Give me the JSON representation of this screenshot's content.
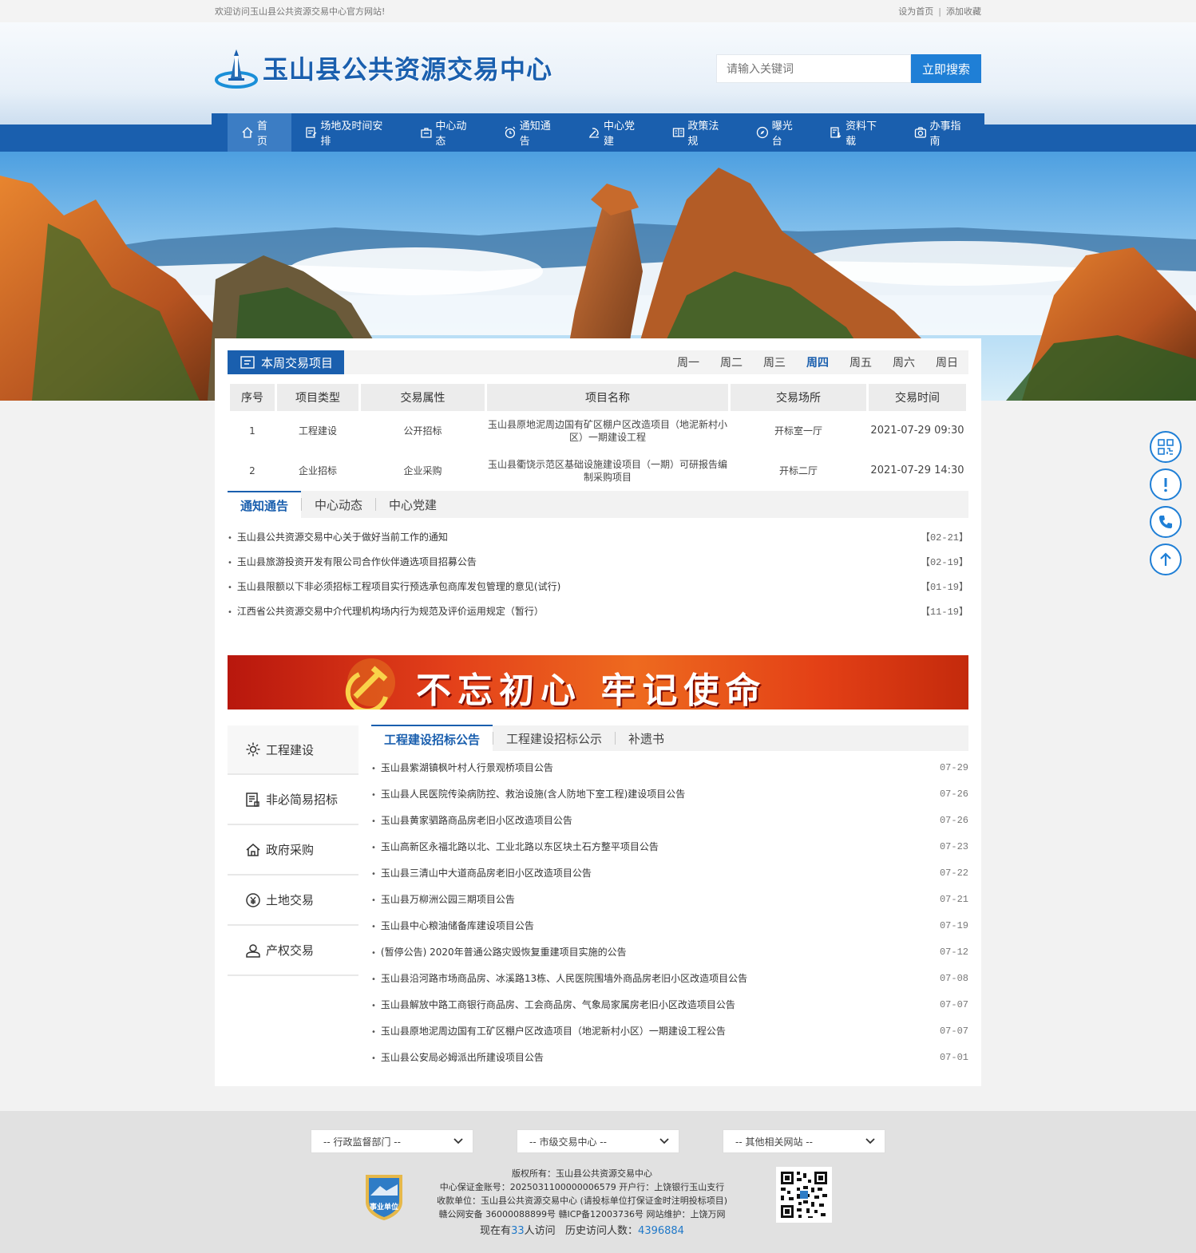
{
  "topbar": {
    "welcome": "欢迎访问玉山县公共资源交易中心官方网站!",
    "set_home": "设为首页",
    "sep": "|",
    "add_fav": "添加收藏"
  },
  "header": {
    "title": "玉山县公共资源交易中心",
    "search_placeholder": "请输入关键词",
    "search_button": "立即搜索"
  },
  "nav": [
    {
      "label": "首页",
      "icon": "home-icon"
    },
    {
      "label": "场地及时间安排",
      "icon": "schedule-icon"
    },
    {
      "label": "中心动态",
      "icon": "briefcase-icon"
    },
    {
      "label": "通知通告",
      "icon": "alarm-icon"
    },
    {
      "label": "中心党建",
      "icon": "party-icon"
    },
    {
      "label": "政策法规",
      "icon": "book-icon"
    },
    {
      "label": "曝光台",
      "icon": "compass-icon"
    },
    {
      "label": "资料下载",
      "icon": "download-icon"
    },
    {
      "label": "办事指南",
      "icon": "camera-icon"
    }
  ],
  "week": {
    "title": "本周交易项目",
    "days": [
      "周一",
      "周二",
      "周三",
      "周四",
      "周五",
      "周六",
      "周日"
    ],
    "active_day": "周四",
    "columns": [
      "序号",
      "项目类型",
      "交易属性",
      "项目名称",
      "交易场所",
      "交易时间"
    ],
    "rows": [
      {
        "no": "1",
        "type": "工程建设",
        "attr": "公开招标",
        "name": "玉山县原地泥周边国有矿区棚户区改造项目（地泥新村小区）一期建设工程",
        "place": "开标室一厅",
        "time": "2021-07-29 09:30"
      },
      {
        "no": "2",
        "type": "企业招标",
        "attr": "企业采购",
        "name": "玉山县衢饶示范区基础设施建设项目（一期）可研报告编制采购项目",
        "place": "开标二厅",
        "time": "2021-07-29 14:30"
      }
    ]
  },
  "notice": {
    "tabs": [
      "通知通告",
      "中心动态",
      "中心党建"
    ],
    "items": [
      {
        "title": "玉山县公共资源交易中心关于做好当前工作的通知",
        "date": "【02-21】"
      },
      {
        "title": "玉山县旅游投资开发有限公司合作伙伴遴选项目招募公告",
        "date": "【02-19】"
      },
      {
        "title": "玉山县限额以下非必须招标工程项目实行预选承包商库发包管理的意见(试行)",
        "date": "【01-19】"
      },
      {
        "title": "江西省公共资源交易中介代理机构场内行为规范及评价运用规定（暂行）",
        "date": "【11-19】"
      }
    ]
  },
  "party_banner": {
    "slogan": "不忘初心 牢记使命"
  },
  "biz": {
    "side": [
      {
        "label": "工程建设",
        "icon": "gear-icon"
      },
      {
        "label": "非必简易招标",
        "icon": "form-icon"
      },
      {
        "label": "政府采购",
        "icon": "house-icon"
      },
      {
        "label": "土地交易",
        "icon": "yuan-icon"
      },
      {
        "label": "产权交易",
        "icon": "user-icon"
      }
    ],
    "tabs": [
      "工程建设招标公告",
      "工程建设招标公示",
      "补遗书"
    ],
    "items": [
      {
        "title": "玉山县紫湖镇枫叶村人行景观桥项目公告",
        "date": "07-29"
      },
      {
        "title": "玉山县人民医院传染病防控、救治设施(含人防地下室工程)建设项目公告",
        "date": "07-26"
      },
      {
        "title": "玉山县黄家驷路商品房老旧小区改造项目公告",
        "date": "07-26"
      },
      {
        "title": "玉山高新区永福北路以北、工业北路以东区块土石方整平项目公告",
        "date": "07-23"
      },
      {
        "title": "玉山县三清山中大道商品房老旧小区改造项目公告",
        "date": "07-22"
      },
      {
        "title": "玉山县万柳洲公园三期项目公告",
        "date": "07-21"
      },
      {
        "title": "玉山县中心粮油储备库建设项目公告",
        "date": "07-19"
      },
      {
        "title": "(暂停公告) 2020年普通公路灾毁恢复重建项目实施的公告",
        "date": "07-12"
      },
      {
        "title": "玉山县沿河路市场商品房、冰溪路13栋、人民医院围墙外商品房老旧小区改造项目公告",
        "date": "07-08"
      },
      {
        "title": "玉山县解放中路工商银行商品房、工会商品房、气象局家属房老旧小区改造项目公告",
        "date": "07-07"
      },
      {
        "title": "玉山县原地泥周边国有工矿区棚户区改造项目（地泥新村小区）一期建设工程公告",
        "date": "07-07"
      },
      {
        "title": "玉山县公安局必姆派出所建设项目公告",
        "date": "07-01"
      }
    ]
  },
  "floats": [
    "qrcode-icon",
    "alert-icon",
    "phone-icon",
    "arrow-up-icon"
  ],
  "footer": {
    "selects": [
      "-- 行政监督部门 --",
      "-- 市级交易中心 --",
      "-- 其他相关网站 --"
    ],
    "badge_text": "事业单位",
    "lines": [
      "版权所有：玉山县公共资源交易中心",
      "中心保证金账号：2025031100000006579    开户行：上饶银行玉山支行",
      "收款单位：玉山县公共资源交易中心 (请投标单位打保证金时注明投标项目)",
      "赣公网安备 36000088899号    赣ICP备12003736号    网站维护：上饶万网"
    ],
    "visit_prefix": "现在有",
    "visit_now": "33",
    "visit_suffix": "人访问",
    "history_label": "历史访问人数：",
    "history_count": "4396884"
  }
}
